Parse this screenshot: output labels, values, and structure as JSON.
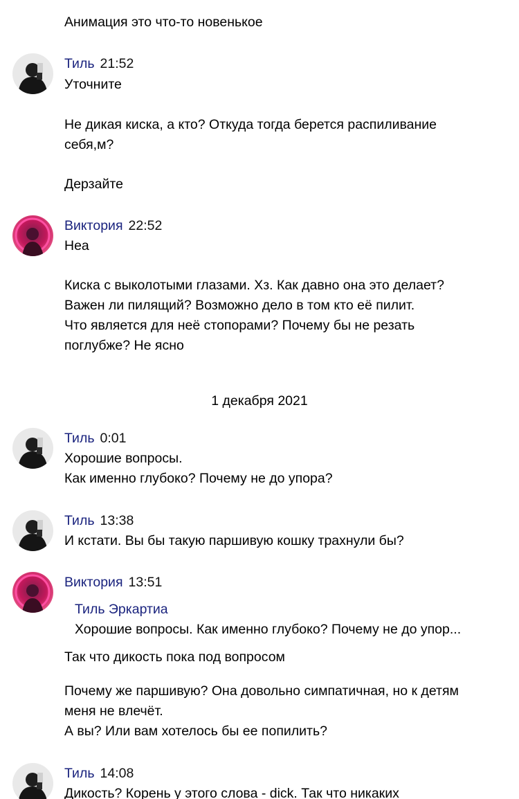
{
  "messages": [
    {
      "continuation": [
        "Анимация это что-то новенькое"
      ]
    },
    {
      "author": "Тиль",
      "time": "21:52",
      "avatar": "til-avatar",
      "paragraphs": [
        [
          "Уточните"
        ],
        [
          "Не дикая киска, а кто? Откуда тогда берется распиливание",
          "себя,м?"
        ],
        [
          "Дерзайте"
        ]
      ]
    },
    {
      "author": "Виктория",
      "time": "22:52",
      "avatar": "viktoria-avatar",
      "paragraphs": [
        [
          "Неа"
        ],
        [
          "Киска с выколотыми глазами. Хз. Как давно она это делает?",
          "Важен ли пилящий? Возможно дело в том кто её пилит.",
          "Что является для неё стопорами? Почему бы не резать",
          "поглубже? Не ясно"
        ]
      ]
    },
    {
      "date_separator": "1 декабря 2021"
    },
    {
      "author": "Тиль",
      "time": "0:01",
      "avatar": "til-avatar",
      "paragraphs": [
        [
          "Хорошие вопросы.",
          "Как именно глубоко? Почему не до упора?"
        ]
      ]
    },
    {
      "author": "Тиль",
      "time": "13:38",
      "avatar": "til-avatar",
      "paragraphs": [
        [
          "И кстати. Вы бы такую паршивую кошку трахнули бы?"
        ]
      ]
    },
    {
      "author": "Виктория",
      "time": "13:51",
      "avatar": "viktoria-avatar",
      "quote": {
        "author": "Тиль Эркартиа",
        "text": "Хорошие вопросы. Как именно глубоко? Почему не до упор..."
      },
      "paragraphs": [
        [
          "Так что дикость пока под вопросом"
        ],
        [
          "Почему же паршивую? Она довольно симпатичная, но к детям",
          "меня не влечёт.",
          "А вы? Или вам хотелось бы ее попилить?"
        ]
      ]
    },
    {
      "author": "Тиль",
      "time": "14:08",
      "avatar": "til-avatar",
      "paragraphs": [
        [
          "Дикость? Корень у этого слова - dick. Так что никаких"
        ]
      ]
    }
  ],
  "colors": {
    "author_name": "#1a237e",
    "text": "#000000",
    "background": "#ffffff"
  }
}
